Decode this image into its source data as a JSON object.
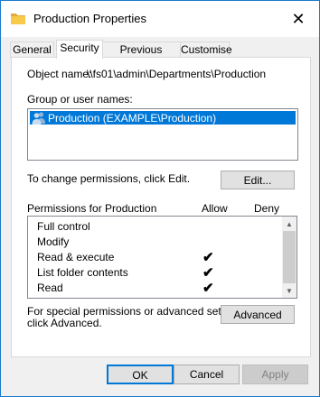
{
  "window": {
    "title": "Production Properties",
    "close_label": "✕"
  },
  "tabs": [
    {
      "label": "General"
    },
    {
      "label": "Security"
    },
    {
      "label": "Previous Versions"
    },
    {
      "label": "Customise"
    }
  ],
  "security": {
    "object_name_label": "Object name:",
    "object_name_value": "\\\\fs01\\admin\\Departments\\Production",
    "group_label": "Group or user names:",
    "groups": [
      {
        "name": "Production (EXAMPLE\\Production)",
        "icon": "users-icon",
        "selected": true
      }
    ],
    "change_text": "To change permissions, click Edit.",
    "edit_button": "Edit...",
    "permissions_header": "Permissions for Production",
    "allow_header": "Allow",
    "deny_header": "Deny",
    "permissions": [
      {
        "name": "Full control",
        "allow": "",
        "deny": ""
      },
      {
        "name": "Modify",
        "allow": "",
        "deny": ""
      },
      {
        "name": "Read & execute",
        "allow": "✔",
        "deny": ""
      },
      {
        "name": "List folder contents",
        "allow": "✔",
        "deny": ""
      },
      {
        "name": "Read",
        "allow": "✔",
        "deny": ""
      }
    ],
    "special_text_line1": "For special permissions or advanced settings,",
    "special_text_line2": "click Advanced.",
    "advanced_button": "Advanced"
  },
  "footer": {
    "ok": "OK",
    "cancel": "Cancel",
    "apply": "Apply"
  },
  "colors": {
    "selection": "#0078d7",
    "window_border": "#1979ca",
    "folder": "#f8c94a"
  }
}
